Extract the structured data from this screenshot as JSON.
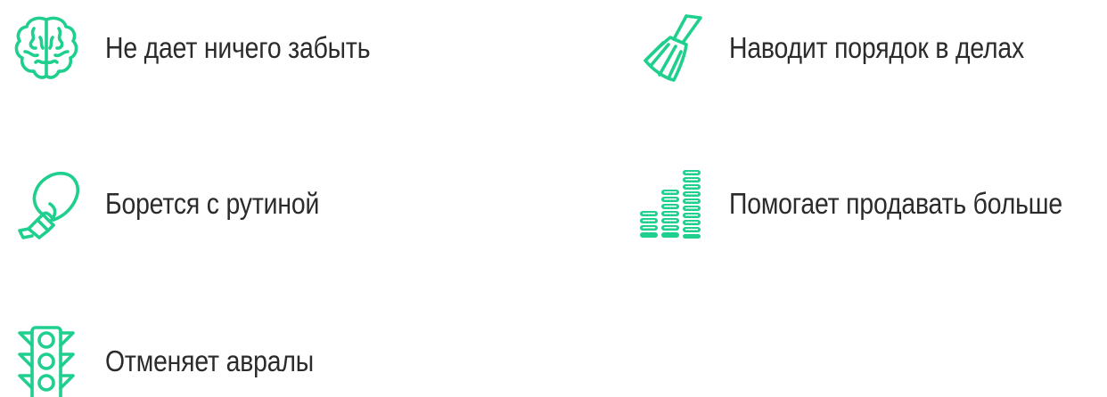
{
  "accent_color": "#1fcf8d",
  "text_color": "#2b2b2b",
  "features": [
    {
      "icon": "brain-icon",
      "label": "Не дает ничего забыть"
    },
    {
      "icon": "broom-icon",
      "label": "Наводит порядок в делах"
    },
    {
      "icon": "boxing-glove-icon",
      "label": "Борется с рутиной"
    },
    {
      "icon": "coin-stacks-icon",
      "label": "Помогает продавать больше"
    },
    {
      "icon": "traffic-light-icon",
      "label": "Отменяет авралы"
    }
  ]
}
